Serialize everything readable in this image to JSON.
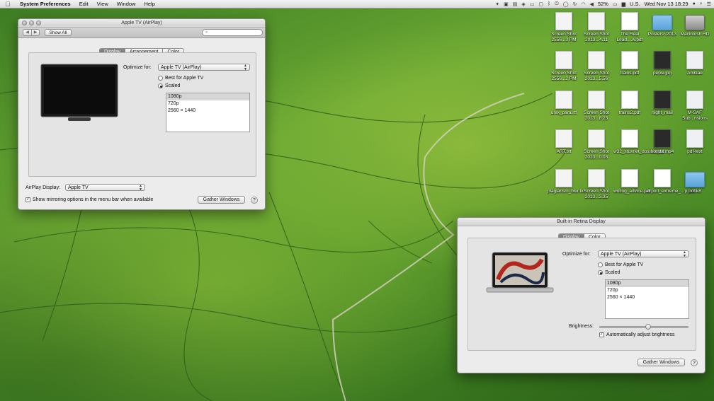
{
  "menubar": {
    "app_name": "System Preferences",
    "menus": [
      "Edit",
      "View",
      "Window",
      "Help"
    ],
    "battery": "52%",
    "input_source": "U.S.",
    "clock": "Wed Nov 13  18:29"
  },
  "desktop_icons": [
    {
      "label": "Screen Shot 2556...3 PM",
      "kind": "image"
    },
    {
      "label": "Screen Shot 2013...4.11",
      "kind": "image"
    },
    {
      "label": "The Real Lead....w.pdf",
      "kind": "pdf"
    },
    {
      "label": "Posters~2013",
      "kind": "folder"
    },
    {
      "label": "Macintosh HD",
      "kind": "drive"
    },
    {
      "label": "Screen Shot 2556...2 PM",
      "kind": "image"
    },
    {
      "label": "Screen Shot 2013...5.56",
      "kind": "image"
    },
    {
      "label": "trains.pdf",
      "kind": "pdf"
    },
    {
      "label": "pepsi.jpg",
      "kind": "image-dark"
    },
    {
      "label": "Amitiae",
      "kind": "script"
    },
    {
      "label": "unix_para.rtf",
      "kind": "text"
    },
    {
      "label": "Screen Shot 2013...8.23",
      "kind": "image"
    },
    {
      "label": "trains2.pdf",
      "kind": "pdf"
    },
    {
      "label": "night_mail",
      "kind": "image-dark"
    },
    {
      "label": "M-SAF Sub...nsions",
      "kind": "script"
    },
    {
      "label": "ART.txt",
      "kind": "text"
    },
    {
      "label": "Screen Shot 2013...0.03",
      "kind": "image"
    },
    {
      "label": "w32_stuxnet_dossier.pdf",
      "kind": "pdf"
    },
    {
      "label": "honda.mp4",
      "kind": "image-dark"
    },
    {
      "label": "pdf-text",
      "kind": "script"
    },
    {
      "label": "plagiarism_blur.txt",
      "kind": "text"
    },
    {
      "label": "Screen Shot 2013...3.35",
      "kind": "image"
    },
    {
      "label": "writing_advice.pdf",
      "kind": "pdf"
    },
    {
      "label": "airport_extreme_...p.pdf",
      "kind": "pdf"
    },
    {
      "label": "book8",
      "kind": "folder"
    }
  ],
  "airplay_window": {
    "title": "Apple TV (AirPlay)",
    "show_all": "Show All",
    "search_placeholder": "",
    "tabs": [
      "Display",
      "Arrangement",
      "Color"
    ],
    "optimize_label": "Optimize for:",
    "optimize_value": "Apple TV (AirPlay)",
    "radio_best": "Best for Apple TV",
    "radio_scaled": "Scaled",
    "resolutions": [
      "1080p",
      "720p",
      "2560 × 1440"
    ],
    "airplay_label": "AirPlay Display:",
    "airplay_value": "Apple TV",
    "mirroring_label": "Show mirroring options in the menu bar when available",
    "gather_windows": "Gather Windows",
    "help": "?"
  },
  "retina_window": {
    "title": "Built-in Retina Display",
    "tabs": [
      "Display",
      "Color"
    ],
    "optimize_label": "Optimize for:",
    "optimize_value": "Apple TV (AirPlay)",
    "radio_best": "Best for Apple TV",
    "radio_scaled": "Scaled",
    "resolutions": [
      "1080p",
      "720p",
      "2560 × 1440"
    ],
    "brightness_label": "Brightness:",
    "brightness_level": 0.55,
    "auto_brightness_label": "Automatically adjust brightness",
    "gather_windows": "Gather Windows",
    "help": "?"
  }
}
